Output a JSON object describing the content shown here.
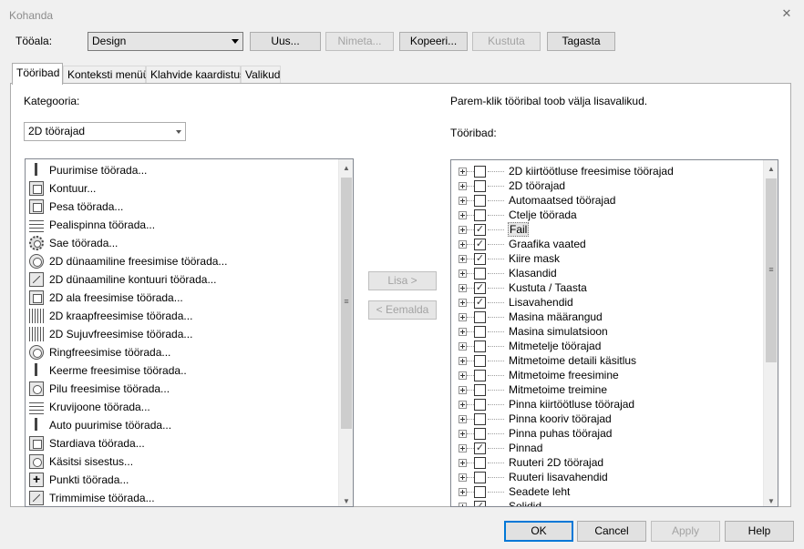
{
  "window": {
    "title": "Kohanda"
  },
  "workspace": {
    "label": "Tööala:",
    "value": "Design"
  },
  "buttons": {
    "new": "Uus...",
    "rename": "Nimeta...",
    "copy": "Kopeeri...",
    "delete": "Kustuta",
    "reset": "Tagasta",
    "add": "Lisa >",
    "remove": "< Eemalda",
    "ok": "OK",
    "cancel": "Cancel",
    "apply": "Apply",
    "help": "Help"
  },
  "tabs": [
    "Tööribad",
    "Konteksti menüü",
    "Klahvide kaardistus",
    "Valikud"
  ],
  "left": {
    "category_label": "Kategooria:",
    "category_value": "2D töörajad",
    "items": [
      {
        "label": "Puurimise töörada...",
        "icon": "drill-icon"
      },
      {
        "label": "Kontuur...",
        "icon": "contour-icon"
      },
      {
        "label": "Pesa töörada...",
        "icon": "pocket-icon"
      },
      {
        "label": "Pealispinna töörada...",
        "icon": "face-icon"
      },
      {
        "label": "Sae töörada...",
        "icon": "saw-icon"
      },
      {
        "label": "2D dünaamiline freesimise töörada...",
        "icon": "dynamic-mill-icon"
      },
      {
        "label": "2D dünaamiline kontuuri töörada...",
        "icon": "dynamic-contour-icon"
      },
      {
        "label": "2D ala freesimise töörada...",
        "icon": "area-mill-icon"
      },
      {
        "label": "2D kraapfreesimise töörada...",
        "icon": "peel-mill-icon"
      },
      {
        "label": "2D Sujuvfreesimise töörada...",
        "icon": "blend-mill-icon"
      },
      {
        "label": "Ringfreesimise töörada...",
        "icon": "circle-mill-icon"
      },
      {
        "label": "Keerme freesimise töörada..",
        "icon": "thread-mill-icon"
      },
      {
        "label": "Pilu freesimise töörada...",
        "icon": "slot-mill-icon"
      },
      {
        "label": "Kruvijoone töörada...",
        "icon": "helix-icon"
      },
      {
        "label": "Auto puurimise töörada...",
        "icon": "auto-drill-icon"
      },
      {
        "label": "Stardiava töörada...",
        "icon": "start-hole-icon"
      },
      {
        "label": "Käsitsi sisestus...",
        "icon": "manual-entry-icon"
      },
      {
        "label": "Punkti töörada...",
        "icon": "point-icon"
      },
      {
        "label": "Trimmimise töörada...",
        "icon": "trim-icon"
      }
    ]
  },
  "right": {
    "hint": "Parem-klik tööribal toob välja lisavalikud.",
    "toolbars_label": "Tööribad:",
    "items": [
      {
        "label": "2D kiirtöötluse freesimise töörajad",
        "checked": false
      },
      {
        "label": "2D töörajad",
        "checked": false
      },
      {
        "label": "Automaatsed töörajad",
        "checked": false
      },
      {
        "label": "Ctelje töörada",
        "checked": false
      },
      {
        "label": "Fail",
        "checked": true,
        "selected": true
      },
      {
        "label": "Graafika vaated",
        "checked": true
      },
      {
        "label": "Kiire mask",
        "checked": true
      },
      {
        "label": "Klasandid",
        "checked": false
      },
      {
        "label": "Kustuta / Taasta",
        "checked": true
      },
      {
        "label": "Lisavahendid",
        "checked": true
      },
      {
        "label": "Masina määrangud",
        "checked": false
      },
      {
        "label": "Masina simulatsioon",
        "checked": false
      },
      {
        "label": "Mitmetelje töörajad",
        "checked": false
      },
      {
        "label": "Mitmetoime detaili käsitlus",
        "checked": false
      },
      {
        "label": "Mitmetoime freesimine",
        "checked": false
      },
      {
        "label": "Mitmetoime treimine",
        "checked": false
      },
      {
        "label": "Pinna kiirtöötluse töörajad",
        "checked": false
      },
      {
        "label": "Pinna kooriv töörajad",
        "checked": false
      },
      {
        "label": "Pinna puhas töörajad",
        "checked": false
      },
      {
        "label": "Pinnad",
        "checked": true
      },
      {
        "label": "Ruuteri 2D töörajad",
        "checked": false
      },
      {
        "label": "Ruuteri lisavahendid",
        "checked": false
      },
      {
        "label": "Seadete leht",
        "checked": false
      },
      {
        "label": "Solidid",
        "checked": true
      }
    ]
  }
}
